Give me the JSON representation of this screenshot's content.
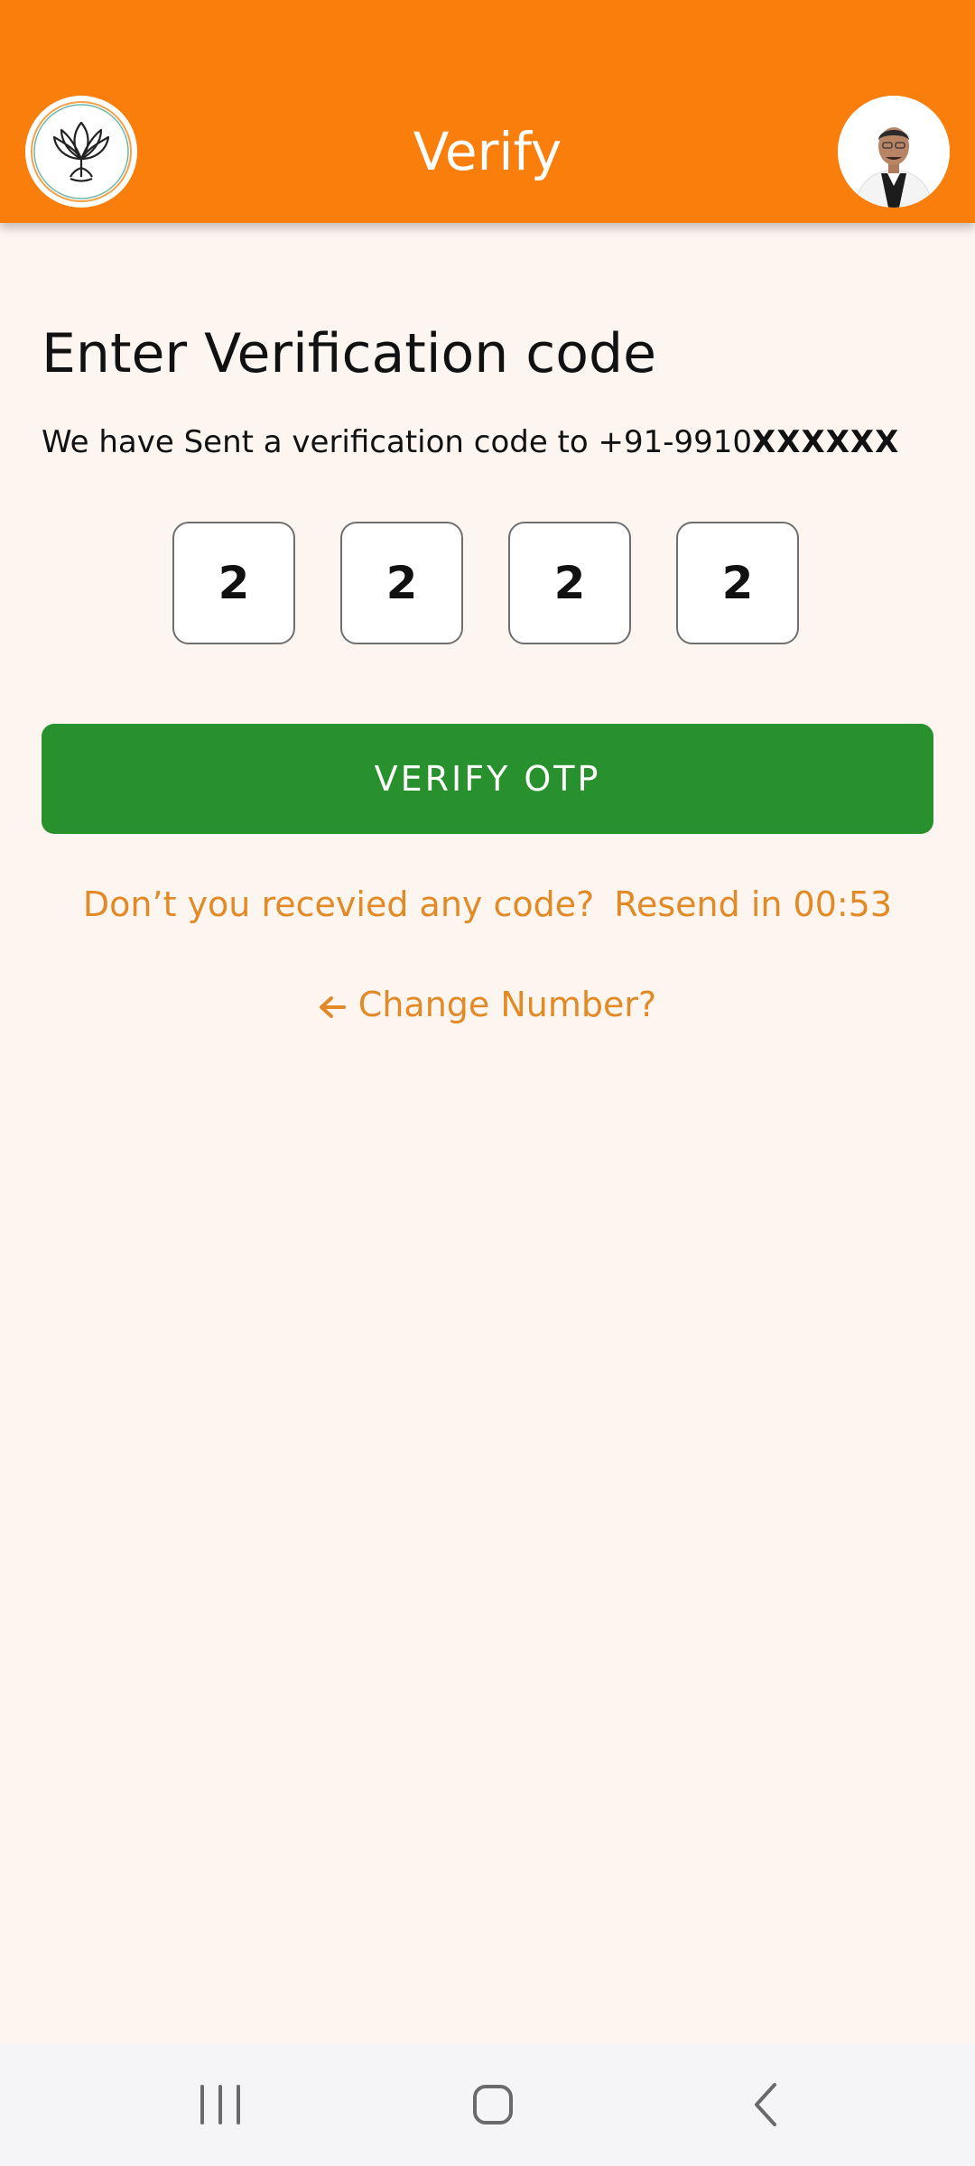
{
  "appbar": {
    "title": "Verify",
    "logo_icon": "lotus-logo-icon",
    "profile_icon": "profile-avatar-icon",
    "color": "#f97e0c"
  },
  "content": {
    "heading": "Enter Verification code",
    "sent_text": "We have Sent a verification code to +91-9910",
    "masked_number": "XXXXXX",
    "otp_digits": [
      "2",
      "2",
      "2",
      "2"
    ],
    "verify_button": "VERIFY OTP",
    "verify_color": "#28912d",
    "resend_question": "Don’t you recevied any code?",
    "resend_timer": "Resend in 00:53",
    "change_number": "Change Number?",
    "accent_color": "#e28a26"
  },
  "navbar": {
    "recent_icon": "recent-apps-icon",
    "home_icon": "home-icon",
    "back_icon": "back-icon"
  }
}
